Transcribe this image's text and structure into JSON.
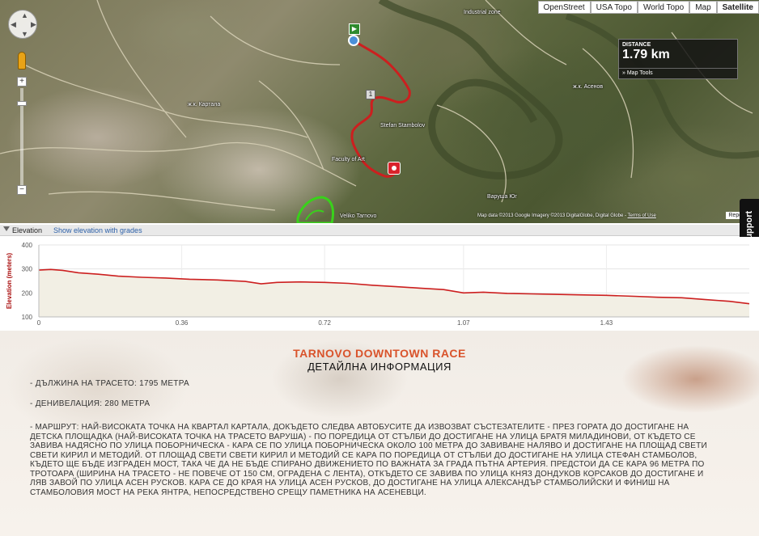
{
  "map": {
    "type_buttons": [
      {
        "label": "OpenStreet",
        "active": false
      },
      {
        "label": "USA Topo",
        "active": false
      },
      {
        "label": "World Topo",
        "active": false
      },
      {
        "label": "Map",
        "active": false
      },
      {
        "label": "Satellite",
        "active": true
      }
    ],
    "distance_label": "DISTANCE",
    "distance_value": "1.79 km",
    "map_tools": "Map Tools",
    "start_marker_label": "▶",
    "km_marker_label": "1",
    "attribution": "Map data ©2013 Google Imagery ©2013 DigitalGlobe, Digital Globe",
    "terms": "Terms of Use",
    "report": "Report a m",
    "support": "Support",
    "labels": {
      "industrial_zone": "Industrial zone",
      "asenov": "ж.к. Асенов",
      "kartala": "ж.к. Картала",
      "faculty": "Faculty of Art",
      "varusha": "Варуша Юг",
      "veliko_tarnovo": "Veliko Tarnovo",
      "stambolov": "Stefan Stambolov"
    },
    "colors": {
      "route": "#cc1f1f",
      "park": "#39d11b"
    }
  },
  "elevation": {
    "header_title": "Elevation",
    "show_grades": "Show elevation with grades"
  },
  "chart_data": {
    "type": "area",
    "ylabel": "Elevation (meters)",
    "xlabel": "",
    "ylim": [
      100,
      400
    ],
    "yticks": [
      100,
      200,
      300,
      400
    ],
    "xlim": [
      0,
      1.79
    ],
    "xticks": [
      "0",
      "0.36",
      "0.72",
      "1.07",
      "1.43"
    ],
    "xtick_values": [
      0,
      0.36,
      0.72,
      1.07,
      1.43
    ],
    "grid": true,
    "series": [
      {
        "x": [
          0,
          0.03,
          0.06,
          0.1,
          0.15,
          0.2,
          0.26,
          0.32,
          0.38,
          0.45,
          0.52,
          0.56,
          0.6,
          0.66,
          0.72,
          0.78,
          0.84,
          0.9,
          0.96,
          1.02,
          1.07,
          1.12,
          1.18,
          1.24,
          1.3,
          1.36,
          1.43,
          1.5,
          1.56,
          1.62,
          1.68,
          1.74,
          1.79
        ],
        "y": [
          295,
          298,
          294,
          284,
          278,
          270,
          265,
          262,
          257,
          254,
          248,
          238,
          244,
          246,
          244,
          240,
          232,
          226,
          220,
          214,
          200,
          203,
          198,
          196,
          194,
          192,
          190,
          186,
          182,
          180,
          172,
          165,
          155
        ],
        "color": "#cc1f1f",
        "fill": "#f2efe4"
      }
    ]
  },
  "race": {
    "title": "TARNOVO DOWNTOWN RACE",
    "subtitle": "ДЕТАЙЛНА ИНФОРМАЦИЯ",
    "length": "- ДЪЛЖИНА НА ТРАСЕТО: 1795 МЕТРА",
    "elevation_gain": "- ДЕНИВЕЛАЦИЯ: 280 МЕТРА",
    "route": "- МАРШРУТ: НАЙ-ВИСОКАТА ТОЧКА НА КВАРТАЛ КАРТАЛА, ДОКЪДЕТО СЛЕДВА АВТОБУСИТЕ ДА ИЗВОЗВАТ СЪСТЕЗАТЕЛИТЕ - ПРЕЗ ГОРАТА ДО ДОСТИГАНЕ НА ДЕТСКА ПЛОЩАДКА (НАЙ-ВИСОКАТА ТОЧКА НА ТРАСЕТО ВАРУША) - ПО ПОРЕДИЦА ОТ СТЪЛБИ ДО ДОСТИГАНЕ НА УЛИЦА БРАТЯ МИЛАДИНОВИ, ОТ КЪДЕТО СЕ ЗАВИВА НАДЯСНО ПО УЛИЦА ПОБОРНИЧЕСКА - КАРА СЕ ПО УЛИЦА ПОБОРНИЧЕСКА ОКОЛО 100 МЕТРА ДО ЗАВИВАНЕ НАЛЯВО И ДОСТИГАНЕ НА ПЛОЩАД СВЕТИ СВЕТИ КИРИЛ И МЕТОДИЙ. ОТ ПЛОЩАД СВЕТИ СВЕТИ КИРИЛ И МЕТОДИЙ СЕ КАРА ПО ПОРЕДИЦА ОТ СТЪЛБИ ДО ДОСТИГАНЕ НА УЛИЦА СТЕФАН СТАМБОЛОВ, КЪДЕТО ЩЕ БЪДЕ ИЗГРАДЕН МОСТ, ТАКА ЧЕ ДА НЕ БЪДЕ СПИРАНО ДВИЖЕНИЕТО ПО ВАЖНАТА ЗА ГРАДА ПЪТНА АРТЕРИЯ. ПРЕДСТОИ ДА СЕ КАРА 96 МЕТРА ПО ТРОТОАРА (ШИРИНА НА ТРАСЕТО - НЕ ПОВЕЧЕ ОТ 150 СМ, ОГРАДЕНА С ЛЕНТА), ОТКЪДЕТО СЕ ЗАВИВА ПО УЛИЦА КНЯЗ ДОНДУКОВ КОРСАКОВ ДО ДОСТИГАНЕ И ЛЯВ ЗАВОЙ ПО УЛИЦА АСЕН РУСКОВ. КАРА СЕ ДО КРАЯ НА УЛИЦА АСЕН РУСКОВ, ДО ДОСТИГАНЕ НА УЛИЦА АЛЕКСАНДЪР СТАМБОЛИЙСКИ И ФИНИШ НА СТАМБОЛОВИЯ МОСТ НА РЕКА ЯНТРА, НЕПОСРЕДСТВЕНО СРЕЩУ ПАМЕТНИКА НА АСЕНЕВЦИ."
  }
}
